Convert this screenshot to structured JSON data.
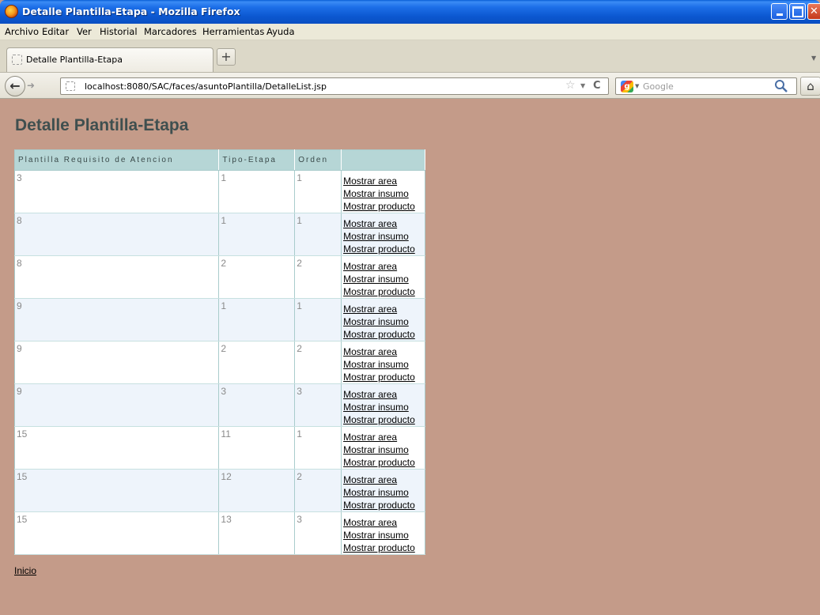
{
  "window": {
    "title": "Detalle Plantilla-Etapa - Mozilla Firefox"
  },
  "menu": [
    "Archivo",
    "Editar",
    "Ver",
    "Historial",
    "Marcadores",
    "Herramientas",
    "Ayuda"
  ],
  "tab": {
    "label": "Detalle Plantilla-Etapa",
    "new_tab": "+"
  },
  "navbar": {
    "url": "localhost:8080/SAC/faces/asuntoPlantilla/DetalleList.jsp",
    "search_placeholder": "Google"
  },
  "page": {
    "title": "Detalle Plantilla-Etapa",
    "columns": [
      "Plantilla Requisito de Atencion",
      "Tipo-Etapa",
      "Orden",
      ""
    ],
    "rows": [
      {
        "plantilla": "3",
        "tipo_etapa": "1",
        "orden": "1"
      },
      {
        "plantilla": "8",
        "tipo_etapa": "1",
        "orden": "1"
      },
      {
        "plantilla": "8",
        "tipo_etapa": "2",
        "orden": "2"
      },
      {
        "plantilla": "9",
        "tipo_etapa": "1",
        "orden": "1"
      },
      {
        "plantilla": "9",
        "tipo_etapa": "2",
        "orden": "2"
      },
      {
        "plantilla": "9",
        "tipo_etapa": "3",
        "orden": "3"
      },
      {
        "plantilla": "15",
        "tipo_etapa": "11",
        "orden": "1"
      },
      {
        "plantilla": "15",
        "tipo_etapa": "12",
        "orden": "2"
      },
      {
        "plantilla": "15",
        "tipo_etapa": "13",
        "orden": "3"
      }
    ],
    "actions": [
      "Mostrar area",
      "Mostrar insumo",
      "Mostrar producto"
    ],
    "inicio": "Inicio"
  }
}
